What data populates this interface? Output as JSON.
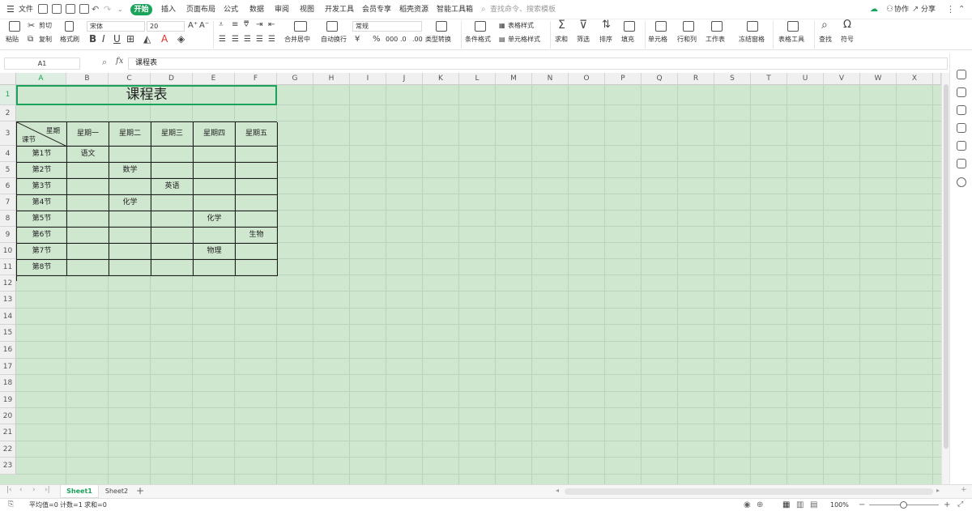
{
  "menubar": {
    "file": "文件",
    "tabs": [
      "开始",
      "插入",
      "页面布局",
      "公式",
      "数据",
      "审阅",
      "视图",
      "开发工具",
      "会员专享",
      "稻壳资源",
      "智能工具箱"
    ],
    "search_placeholder": "查找命令、搜索模板",
    "collab": "协作",
    "share": "分享"
  },
  "toolbar": {
    "paste": "粘贴",
    "cut": "剪切",
    "copy": "复制",
    "format_painter": "格式刷",
    "font_name": "宋体",
    "font_size": "20",
    "merge_center": "合并居中",
    "wrap_text": "自动换行",
    "number_format": "常规",
    "type_convert": "类型转换",
    "conditional_format": "条件格式",
    "table_style": "表格样式",
    "cell_style": "单元格样式",
    "sum": "求和",
    "filter": "筛选",
    "sort": "排序",
    "fill": "填充",
    "cells": "单元格",
    "rows_cols": "行和列",
    "worksheet": "工作表",
    "freeze": "冻结窗格",
    "table_tools": "表格工具",
    "find": "查找",
    "symbol": "符号"
  },
  "formula_bar": {
    "name_box": "A1",
    "fx": "fx",
    "content": "课程表"
  },
  "columns": [
    "A",
    "B",
    "C",
    "D",
    "E",
    "F",
    "G",
    "H",
    "I",
    "J",
    "K",
    "L",
    "M",
    "N",
    "O",
    "P",
    "Q",
    "R",
    "S",
    "T",
    "U",
    "V",
    "W",
    "X"
  ],
  "rows": [
    "1",
    "2",
    "3",
    "4",
    "5",
    "6",
    "7",
    "8",
    "9",
    "10",
    "11",
    "12",
    "13",
    "14",
    "15",
    "16",
    "17",
    "18",
    "19",
    "20",
    "21",
    "22",
    "23"
  ],
  "sheet": {
    "title": "课程表",
    "diag_top": "星期",
    "diag_bottom": "课节",
    "headers": [
      "星期一",
      "星期二",
      "星期三",
      "星期四",
      "星期五"
    ],
    "periods": [
      "第1节",
      "第2节",
      "第3节",
      "第4节",
      "第5节",
      "第6节",
      "第7节",
      "第8节"
    ],
    "cells": [
      [
        "语文",
        "",
        "",
        "",
        ""
      ],
      [
        "",
        "数学",
        "",
        "",
        ""
      ],
      [
        "",
        "",
        "英语",
        "",
        ""
      ],
      [
        "",
        "化学",
        "",
        "",
        ""
      ],
      [
        "",
        "",
        "",
        "化学",
        ""
      ],
      [
        "",
        "",
        "",
        "",
        "生物"
      ],
      [
        "",
        "",
        "",
        "物理",
        ""
      ],
      [
        "",
        "",
        "",
        "",
        ""
      ]
    ]
  },
  "sheet_tabs": [
    "Sheet1",
    "Sheet2"
  ],
  "status": {
    "avg": "平均值=0",
    "count": "计数=1",
    "sum": "求和=0",
    "zoom": "100%"
  },
  "colors": {
    "accent": "#1aa35a",
    "grid_bg": "#cfe7cf"
  }
}
